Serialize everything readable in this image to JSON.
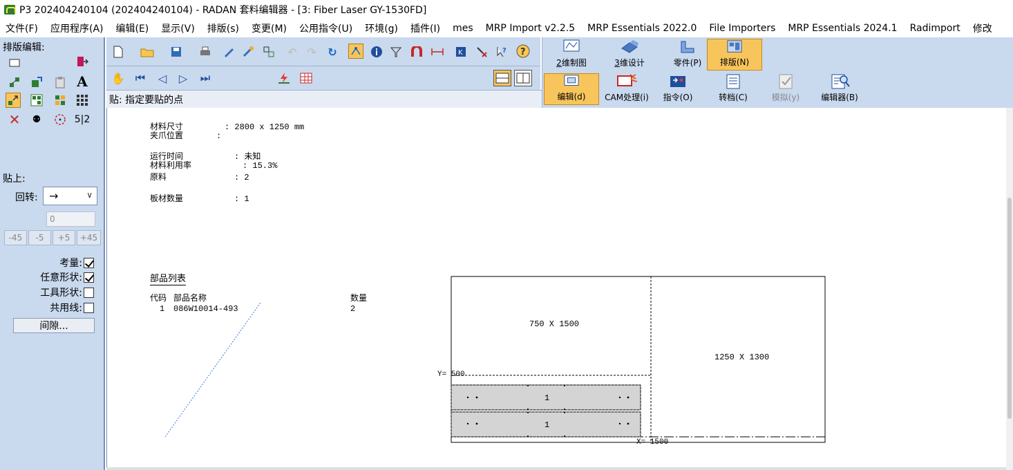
{
  "window": {
    "title": "P3 202404240104 (202404240104) - RADAN 套料编辑器 - [3: Fiber Laser GY-1530FD]"
  },
  "menu": [
    "文件(F)",
    "应用程序(A)",
    "编辑(E)",
    "显示(V)",
    "排版(s)",
    "变更(M)",
    "公用指令(U)",
    "环境(g)",
    "插件(I)",
    "mes",
    "MRP Import v2.2.5",
    "MRP Essentials 2022.0",
    "File Importers",
    "MRP Essentials 2024.1",
    "Radimport",
    "修改"
  ],
  "left_panel": {
    "heading": "排版编辑:",
    "paste_label": "贴上:",
    "rotate_label": "回转:",
    "rotate_value": "→",
    "angle_value": "0",
    "step_buttons": [
      "-45",
      "-5",
      "+5",
      "+45"
    ],
    "checks": [
      {
        "label": "考量:",
        "checked": true
      },
      {
        "label": "任意形状:",
        "checked": true
      },
      {
        "label": "工具形状:",
        "checked": false
      },
      {
        "label": "共用线:",
        "checked": false
      }
    ],
    "gap_button": "间隙..."
  },
  "prompt": "贴: 指定要贴的点",
  "mode_buttons": [
    {
      "label": "2维制图",
      "key": "2",
      "rest": "维制图",
      "active": false,
      "disabled": false
    },
    {
      "label": "3维设计",
      "key": "3",
      "rest": "维设计",
      "active": false,
      "disabled": false
    },
    {
      "label": "零件(P)",
      "active": false,
      "disabled": false
    },
    {
      "label": "排版(N)",
      "active": true,
      "disabled": false
    },
    {
      "label": "编辑(d)",
      "active": true,
      "disabled": false
    },
    {
      "label": "CAM处理(i)",
      "active": false,
      "disabled": false
    },
    {
      "label": "指令(O)",
      "active": false,
      "disabled": false
    },
    {
      "label": "转档(C)",
      "active": false,
      "disabled": false
    },
    {
      "label": "模拟(y)",
      "active": false,
      "disabled": true
    },
    {
      "label": "编辑器(B)",
      "active": false,
      "disabled": false
    }
  ],
  "report": {
    "material_size_label": "材料尺寸",
    "material_size_value": ": 2800 x 1250 mm",
    "clamp_label": "夹爪位置",
    "clamp_value": ":",
    "run_time_label": "运行时间",
    "run_time_value": ": 未知",
    "utilization_label": "材料利用率",
    "utilization_value": ": 15.3%",
    "raw_label": "原料",
    "raw_value": ": 2",
    "sheet_count_label": "板材数量",
    "sheet_count_value": ": 1",
    "parts_heading": "部品列表",
    "col_code": "代码",
    "col_name": "部品名称",
    "col_qty": "数量",
    "part_code": "1",
    "part_name": "086W10014-493",
    "part_qty": "2"
  },
  "sheet": {
    "remnant_left": "750 X 1500",
    "remnant_right": "1250 X 1300",
    "y_mark": "Y= 500",
    "x_mark": "X= 1500",
    "part_labels": [
      "1",
      "1"
    ]
  },
  "colors": {
    "panel": "#c9d9ee",
    "active": "#f8c55c",
    "part_fill": "#d4d4d4",
    "dotted_line": "#3c7fd6"
  }
}
